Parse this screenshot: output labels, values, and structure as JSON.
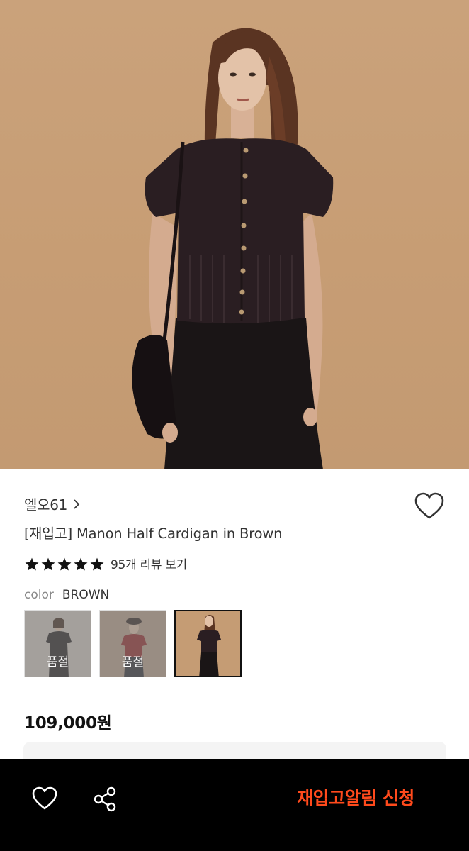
{
  "product": {
    "brand": "엘오61",
    "title": "[재입고] Manon Half Cardigan in Brown",
    "rating": 5,
    "review_link": "95개 리뷰 보기",
    "color_label": "color",
    "color_value": "BROWN",
    "price": "109,000원"
  },
  "swatches": [
    {
      "label": "품절",
      "sold_out": true
    },
    {
      "label": "품절",
      "sold_out": true
    },
    {
      "label": "",
      "sold_out": false,
      "selected": true
    }
  ],
  "bottom_bar": {
    "restock_label": "재입고알림 신청"
  },
  "colors": {
    "accent": "#ff4a1c",
    "bottom_bar_bg": "#000000",
    "hero_bg": "#c89f76"
  },
  "icons": {
    "brand_chevron": "chevron-right-icon",
    "wish": "heart-outline-icon",
    "share": "share-icon",
    "star": "star-filled-icon"
  }
}
